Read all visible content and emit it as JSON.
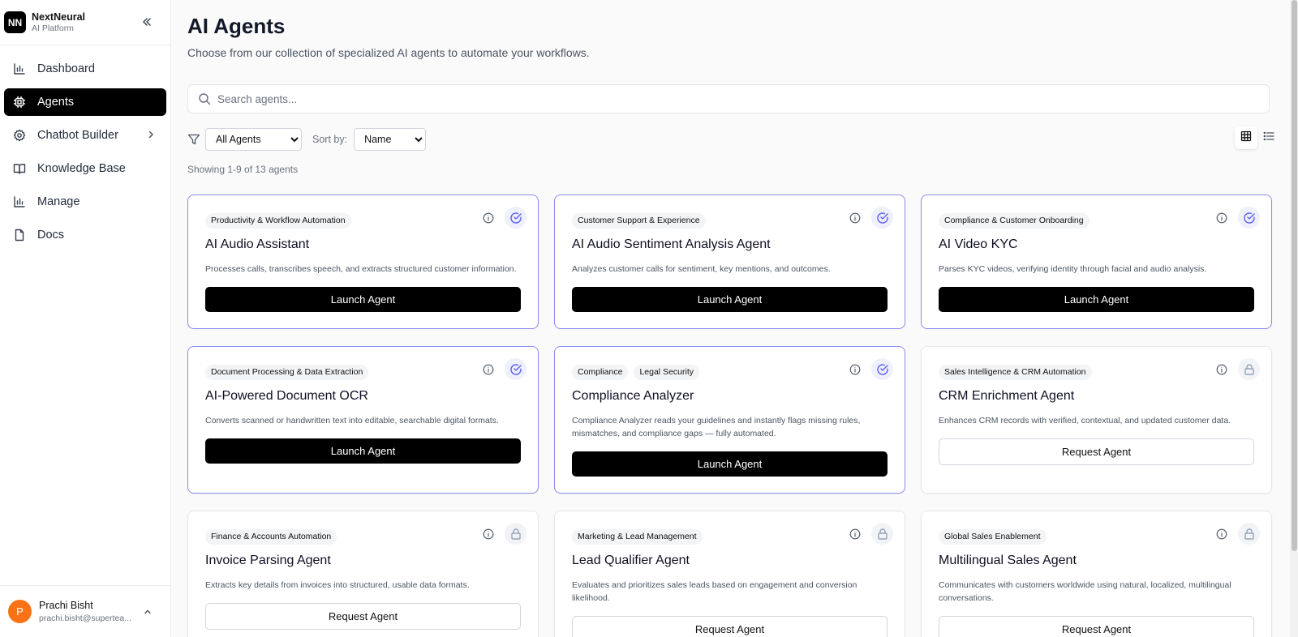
{
  "brand": {
    "logo_text": "NN",
    "name": "NextNeural",
    "subtitle": "AI Platform"
  },
  "sidebar": {
    "items": [
      {
        "label": "Dashboard",
        "icon": "bar-chart-icon",
        "active": false
      },
      {
        "label": "Agents",
        "icon": "cpu-icon",
        "active": true
      },
      {
        "label": "Chatbot Builder",
        "icon": "gear-icon",
        "active": false,
        "has_submenu": true
      },
      {
        "label": "Knowledge Base",
        "icon": "book-icon",
        "active": false
      },
      {
        "label": "Manage",
        "icon": "bar-chart-icon",
        "active": false
      },
      {
        "label": "Docs",
        "icon": "file-icon",
        "active": false
      }
    ]
  },
  "user": {
    "initial": "P",
    "name": "Prachi Bisht",
    "email": "prachi.bisht@supertea..."
  },
  "page": {
    "title": "AI Agents",
    "subtitle": "Choose from our collection of specialized AI agents to automate your workflows."
  },
  "search": {
    "placeholder": "Search agents...",
    "value": ""
  },
  "filters": {
    "category_selected": "All Agents",
    "sort_label": "Sort by:",
    "sort_selected": "Name"
  },
  "showing_text": "Showing 1-9 of 13 agents",
  "colors": {
    "accent": "#8b8cf0",
    "primary_button": "#000000",
    "avatar": "#f97316"
  },
  "cards": [
    {
      "tags": [
        "Productivity & Workflow Automation"
      ],
      "title": "AI Audio Assistant",
      "description": "Processes calls, transcribes speech, and extracts structured customer information.",
      "status": "unlocked",
      "button": "Launch Agent"
    },
    {
      "tags": [
        "Customer Support & Experience"
      ],
      "title": "AI Audio Sentiment Analysis Agent",
      "description": "Analyzes customer calls for sentiment, key mentions, and outcomes.",
      "status": "unlocked",
      "button": "Launch Agent"
    },
    {
      "tags": [
        "Compliance & Customer Onboarding"
      ],
      "title": "AI Video KYC",
      "description": "Parses KYC videos, verifying identity through facial and audio analysis.",
      "status": "unlocked",
      "button": "Launch Agent"
    },
    {
      "tags": [
        "Document Processing & Data Extraction"
      ],
      "title": "AI-Powered Document OCR",
      "description": "Converts scanned or handwritten text into editable, searchable digital formats.",
      "status": "unlocked",
      "button": "Launch Agent"
    },
    {
      "tags": [
        "Compliance",
        "Legal Security"
      ],
      "title": "Compliance Analyzer",
      "description": "Compliance Analyzer reads your guidelines and instantly flags missing rules, mismatches, and compliance gaps — fully automated.",
      "status": "unlocked",
      "button": "Launch Agent"
    },
    {
      "tags": [
        "Sales Intelligence & CRM Automation"
      ],
      "title": "CRM Enrichment Agent",
      "description": "Enhances CRM records with verified, contextual, and updated customer data.",
      "status": "locked",
      "button": "Request Agent"
    },
    {
      "tags": [
        "Finance & Accounts Automation"
      ],
      "title": "Invoice Parsing Agent",
      "description": "Extracts key details from invoices into structured, usable data formats.",
      "status": "locked",
      "button": "Request Agent"
    },
    {
      "tags": [
        "Marketing & Lead Management"
      ],
      "title": "Lead Qualifier Agent",
      "description": "Evaluates and prioritizes sales leads based on engagement and conversion likelihood.",
      "status": "locked",
      "button": "Request Agent"
    },
    {
      "tags": [
        "Global Sales Enablement"
      ],
      "title": "Multilingual Sales Agent",
      "description": "Communicates with customers worldwide using natural, localized, multilingual conversations.",
      "status": "locked",
      "button": "Request Agent"
    }
  ]
}
